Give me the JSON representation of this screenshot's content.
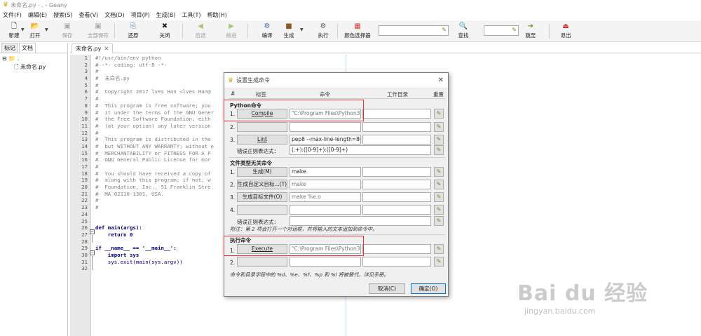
{
  "window": {
    "title": "未命名.py - . - Geany"
  },
  "menu": [
    "文件(F)",
    "编辑(E)",
    "搜索(S)",
    "查看(V)",
    "文档(D)",
    "项目(P)",
    "生成(B)",
    "工具(T)",
    "帮助(H)"
  ],
  "toolbar": {
    "new_label": "新建",
    "open_label": "打开",
    "save_label": "保存",
    "save_all_label": "全部保存",
    "revert_label": "还原",
    "close_label": "关闭",
    "back_label": "后退",
    "forward_label": "前进",
    "compile_label": "编译",
    "build_label": "生成",
    "execute_label": "执行",
    "color_label": "颜色选择器",
    "find_label": "查找",
    "goto_label": "跳至",
    "quit_label": "退出"
  },
  "sidebar": {
    "tabs": [
      "标记",
      "文档"
    ],
    "tree_root": ".",
    "tree_file": "未命名.py"
  },
  "editor": {
    "tab_label": "未命名.py",
    "tab_close": "✕",
    "line_numbers": [
      "1",
      "2",
      "3",
      "4",
      "5",
      "6",
      "7",
      "8",
      "9",
      "10",
      "11",
      "12",
      "13",
      "14",
      "15",
      "16",
      "17",
      "18",
      "19",
      "20",
      "21",
      "22",
      "23",
      "24",
      "25",
      "26",
      "27",
      "28",
      "29",
      "30",
      "31",
      "32"
    ],
    "code": [
      "#!/usr/bin/env python",
      "# -*- coding: utf-8 -*-",
      "#",
      "#  未命名.py",
      "#",
      "#  Copyright 2017 lves Han <lves Han@",
      "#",
      "#  This program is free software; you",
      "#  it under the terms of the GNU Gener",
      "#  the Free Software Foundation; eith",
      "#  (at your option) any later version",
      "#",
      "#  This program is distributed in the",
      "#  but WITHOUT ANY WARRANTY; without e",
      "#  MERCHANTABILITY or FITNESS FOR A P",
      "#  GNU General Public License for mor",
      "#",
      "#  You should have received a copy of",
      "#  along with this program; if not, w",
      "#  Foundation, Inc., 51 Franklin Stre",
      "#  MA 02110-1301, USA.",
      "#",
      "#",
      "",
      "",
      "def main(args):",
      "    return 0",
      "",
      "if __name__ == '__main__':",
      "    import sys",
      "    sys.exit(main(sys.argv))",
      ""
    ]
  },
  "dialog": {
    "title": "设置生成命令",
    "close": "✕",
    "headers": {
      "num": "#",
      "label": "标签",
      "command": "命令",
      "workdir": "工作目录",
      "reset": "重置"
    },
    "python_section": "Python命令",
    "python_rows": [
      {
        "num": "1.",
        "label": "Compile",
        "command": "\"C:\\Program Files\\Python3"
      },
      {
        "num": "2.",
        "label": "",
        "command": ""
      },
      {
        "num": "3.",
        "label": "Lint",
        "command": "pep8 --max-line-length=80"
      }
    ],
    "regex_label": "错误正则表达式：",
    "python_regex": "(.+):([0-9]+):([0-9]+)",
    "independent_section": "文件类型无关命令",
    "independent_rows": [
      {
        "num": "1.",
        "label": "生成(M)",
        "command": "make"
      },
      {
        "num": "2.",
        "label": "生成自定义目标...(T)",
        "command": "make"
      },
      {
        "num": "3.",
        "label": "生成目标文件(O)",
        "command": "make %e.o"
      },
      {
        "num": "4.",
        "label": "",
        "command": ""
      }
    ],
    "independent_regex": "",
    "note1": "附注：第 2 项会打开一个对话框，并将输入的文本追加到命令中。",
    "execute_section": "执行命令",
    "execute_rows": [
      {
        "num": "1.",
        "label": "Execute",
        "command": "\"C:\\Program Files\\Python3"
      },
      {
        "num": "2.",
        "label": "",
        "command": ""
      }
    ],
    "note2": "命令和目录字段中的 %d、%e、%f、%p 和 %l 将被替代，详见手册。",
    "cancel_label": "取消(C)",
    "ok_label": "确定(O)"
  },
  "watermark": {
    "logo": "Bai du 经验",
    "url": "jingyan.baidu.com"
  },
  "colors": {
    "highlight": "#e03030",
    "comment": "#808080",
    "keyword": "#00007f"
  }
}
